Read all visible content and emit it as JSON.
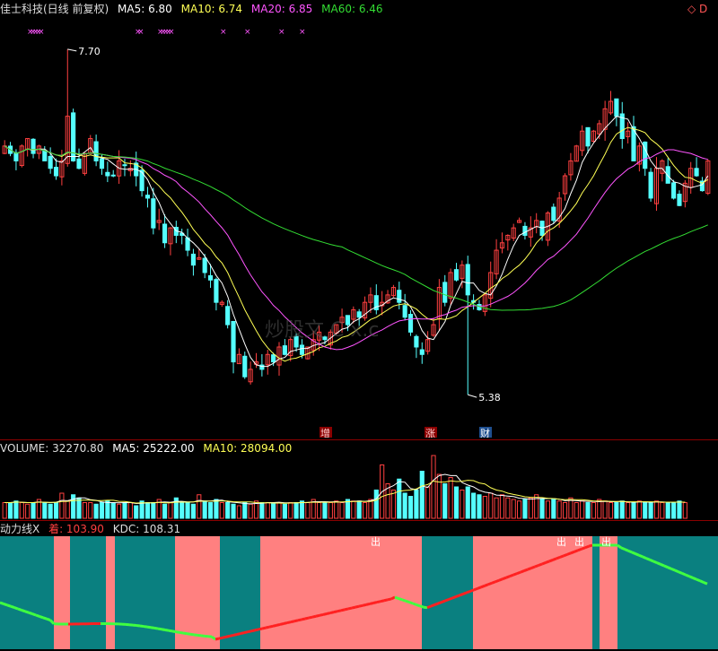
{
  "header": {
    "title": "佳士科技(日线 前复权)",
    "ma5": "MA5: 6.80",
    "ma10": "MA10: 6.74",
    "ma20": "MA20: 6.85",
    "ma60": "MA60: 6.46",
    "corner_icon": "◇ D"
  },
  "volume_header": {
    "label": "VOLUME: 32270.80",
    "ma5": "MA5: 25222.00",
    "ma10": "MA10: 28094.00"
  },
  "indicator_header": {
    "label": "动力线X",
    "a": "着: 103.90",
    "b": "KDC: 108.31"
  },
  "annotations": {
    "high_label": "7.70",
    "low_label": "5.38",
    "marks": [
      "增",
      "涨",
      "财"
    ],
    "out_label": "出",
    "watermark": "炒股文 C    x.c"
  },
  "colors": {
    "up": "#ff4040",
    "down": "#55ffff",
    "ma5": "#ffffff",
    "ma10": "#ffff55",
    "ma20": "#ff55ff",
    "ma60": "#33dd33",
    "bg_teal": "#0a8080",
    "bg_pink": "#ff8080"
  },
  "chart_data": {
    "type": "candlestick",
    "symbol": "佳士科技",
    "ylim": [
      5.2,
      7.85
    ],
    "high": 7.7,
    "low": 5.38,
    "closes": [
      7.05,
      7.0,
      6.95,
      7.05,
      7.1,
      7.0,
      7.05,
      6.95,
      6.9,
      6.85,
      6.95,
      7.25,
      6.95,
      6.9,
      7.0,
      7.1,
      6.95,
      6.9,
      6.85,
      6.85,
      6.95,
      6.92,
      6.9,
      6.85,
      6.75,
      6.7,
      6.5,
      6.55,
      6.4,
      6.5,
      6.45,
      6.45,
      6.35,
      6.25,
      6.3,
      6.2,
      6.15,
      6.0,
      6.0,
      5.85,
      5.6,
      5.65,
      5.5,
      5.55,
      5.6,
      5.55,
      5.65,
      5.6,
      5.7,
      5.65,
      5.75,
      5.7,
      5.65,
      5.7,
      5.75,
      5.8,
      5.75,
      5.8,
      5.85,
      5.9,
      5.85,
      5.95,
      5.9,
      6.0,
      6.05,
      5.95,
      6.0,
      6.05,
      6.1,
      6.0,
      5.9,
      5.8,
      5.7,
      5.65,
      5.75,
      5.85,
      6.1,
      6.0,
      6.2,
      6.15,
      6.25,
      6.05,
      6.0,
      5.95,
      6.05,
      6.2,
      6.35,
      6.4,
      6.45,
      6.5,
      6.55,
      6.45,
      6.5,
      6.55,
      6.45,
      6.6,
      6.55,
      6.7,
      6.85,
      6.95,
      7.05,
      7.15,
      7.05,
      7.15,
      7.2,
      7.3,
      7.35,
      7.25,
      7.1,
      7.15,
      6.95,
      7.05,
      6.9,
      6.7,
      6.9,
      6.95,
      6.8,
      6.7,
      6.65,
      6.8,
      6.9,
      6.85,
      6.75,
      6.95
    ],
    "volumes": [
      1,
      1,
      1.1,
      1,
      0.9,
      1,
      1.2,
      1,
      0.9,
      1,
      1.6,
      1.1,
      1.5,
      1.3,
      1,
      1,
      0.9,
      1,
      1.1,
      1,
      0.9,
      1,
      1,
      0.8,
      1.1,
      1,
      1,
      1.2,
      0.9,
      1,
      1.3,
      1,
      1,
      0.9,
      1.5,
      1.1,
      1,
      1.2,
      1,
      1,
      0.9,
      0.8,
      1,
      0.9,
      1.1,
      1,
      1,
      1,
      1,
      0.9,
      1,
      1,
      1.1,
      1,
      1.2,
      1,
      1,
      1,
      1.1,
      1,
      1.2,
      1.1,
      1.1,
      1,
      1.2,
      1.8,
      3.4,
      2.2,
      1.8,
      2.5,
      1.6,
      1.4,
      1.8,
      3.0,
      2.0,
      4.0,
      2.8,
      2.2,
      2.6,
      2.0,
      1.8,
      2.0,
      1.6,
      1.5,
      1.4,
      1.6,
      1.3,
      1.5,
      1.3,
      1.2,
      1.1,
      1.2,
      1.3,
      1.5,
      1.2,
      1.1,
      1.2,
      1.1,
      1,
      1.3,
      1,
      1.1,
      1,
      1,
      1.2,
      1.1,
      1,
      1,
      1.1,
      1,
      1,
      1.1,
      1,
      1,
      1.1,
      1,
      1,
      1,
      1.1,
      1
    ],
    "series": [
      {
        "name": "MA5"
      },
      {
        "name": "MA10"
      },
      {
        "name": "MA20"
      },
      {
        "name": "MA60"
      }
    ]
  }
}
